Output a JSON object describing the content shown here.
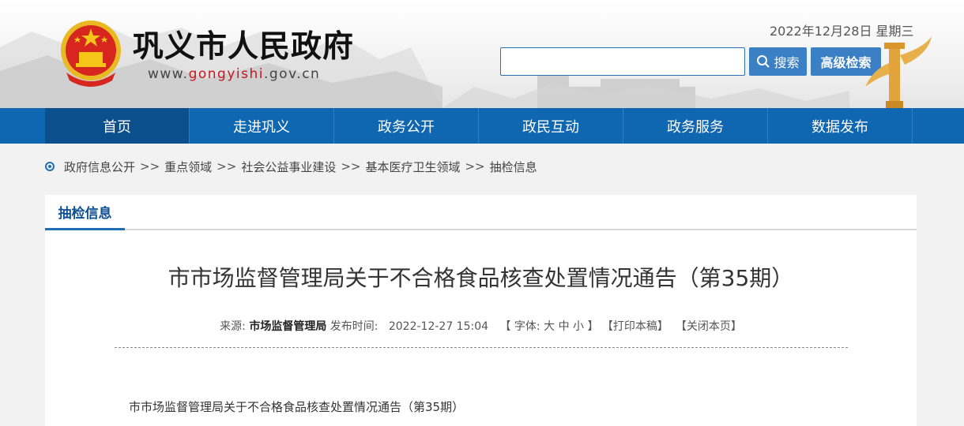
{
  "header": {
    "title": "巩义市人民政府",
    "url_prefix": "www.",
    "url_domain": "gongyishi",
    "url_suffix": ".gov.cn",
    "date": "2022年12月28日 星期三",
    "search_placeholder": "",
    "search_label": "搜索",
    "advanced_search_label": "高级检索"
  },
  "nav": {
    "items": [
      {
        "label": "首页",
        "active": true
      },
      {
        "label": "走进巩义"
      },
      {
        "label": "政务公开"
      },
      {
        "label": "政民互动"
      },
      {
        "label": "政务服务"
      },
      {
        "label": "数据发布"
      }
    ]
  },
  "breadcrumb": {
    "items": [
      "政府信息公开",
      "重点领域",
      "社会公益事业建设",
      "基本医疗卫生领域",
      "抽检信息"
    ],
    "separator": ">>"
  },
  "content": {
    "tab_label": "抽检信息",
    "title": "市市场监督管理局关于不合格食品核查处置情况通告（第35期）",
    "source_label": "来源: ",
    "source_value": "市场监督管理局",
    "publish_label": " 发布时间: ",
    "publish_time": "2022-12-27 15:04",
    "font_label": "【 字体: ",
    "font_large": "大",
    "font_medium": "中",
    "font_small": "小",
    "font_close": " 】",
    "print_label": "【打印本稿】",
    "close_label": "【关闭本页】",
    "body_first_line": "市市场监督管理局关于不合格食品核查处置情况通告（第35期）"
  },
  "colors": {
    "nav_bg": "#0f67b1",
    "nav_active": "#0b4f8c",
    "accent_red": "#c8161d",
    "button_blue": "#3b7fc4"
  }
}
